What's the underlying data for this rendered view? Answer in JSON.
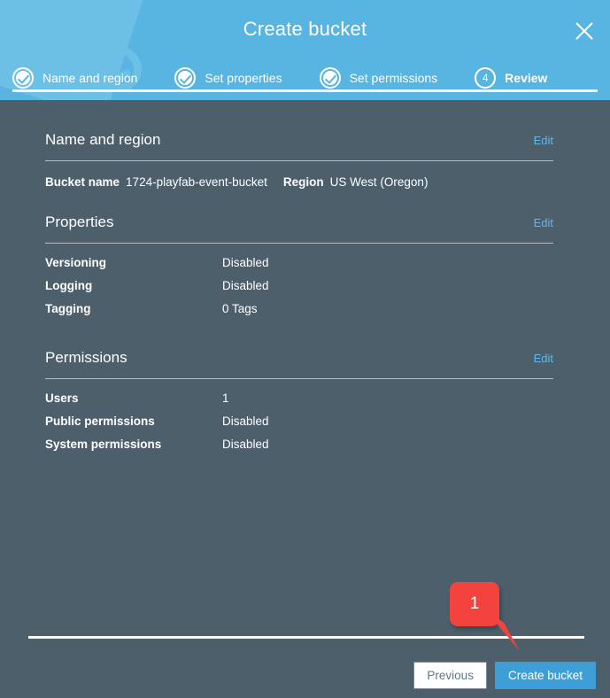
{
  "header": {
    "title": "Create bucket",
    "close_icon": "close-icon",
    "steps": [
      {
        "label": "Name and region",
        "state": "done",
        "marker": "check-icon"
      },
      {
        "label": "Set properties",
        "state": "done",
        "marker": "check-icon"
      },
      {
        "label": "Set permissions",
        "state": "done",
        "marker": "check-icon"
      },
      {
        "label": "Review",
        "state": "current",
        "marker": "4"
      }
    ]
  },
  "sections": {
    "name_and_region": {
      "title": "Name and region",
      "edit_label": "Edit",
      "bucket_name_label": "Bucket name",
      "bucket_name_value": "1724-playfab-event-bucket",
      "region_label": "Region",
      "region_value": "US West (Oregon)"
    },
    "properties": {
      "title": "Properties",
      "edit_label": "Edit",
      "rows": [
        {
          "label": "Versioning",
          "value": "Disabled"
        },
        {
          "label": "Logging",
          "value": "Disabled"
        },
        {
          "label": "Tagging",
          "value": "0 Tags"
        }
      ]
    },
    "permissions": {
      "title": "Permissions",
      "edit_label": "Edit",
      "rows": [
        {
          "label": "Users",
          "value": "1"
        },
        {
          "label": "Public permissions",
          "value": "Disabled"
        },
        {
          "label": "System permissions",
          "value": "Disabled"
        }
      ]
    }
  },
  "footer": {
    "previous_label": "Previous",
    "create_label": "Create bucket"
  },
  "annotation": {
    "number": "1",
    "color": "#f4433c"
  },
  "colors": {
    "header_blue": "#58b4e0",
    "body_slate": "#4c5f6b",
    "link_blue": "#63b8e8",
    "primary_button": "#3d9fd6",
    "callout_red": "#f4433c"
  }
}
